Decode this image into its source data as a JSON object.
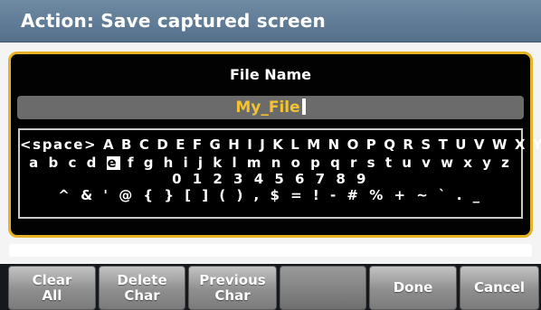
{
  "title": "Action: Save captured screen",
  "dialog": {
    "label": "File Name",
    "file_name_value": "My_File"
  },
  "charset": {
    "row1": "<space> A B C D E F G H I J K L M N O P Q R S T U V W X Y Z",
    "row2_before": "a b c d ",
    "row2_selected": "e",
    "row2_after": " f g h i j k l m n o p q r s t u v w x y z",
    "row3": "0 1 2 3 4 5 6 7 8 9",
    "row4": "^ & ' @ { } [ ] ( ) , $ = ! - # % + ~ ` . _"
  },
  "softkeys": {
    "clear_all": [
      "Clear",
      "All"
    ],
    "delete_char": [
      "Delete",
      "Char"
    ],
    "previous_char": [
      "Previous",
      "Char"
    ],
    "done": "Done",
    "cancel": "Cancel"
  },
  "colors": {
    "title_bar": "#6381a0",
    "dialog_border": "#e6b325",
    "file_name_text": "#f3c332"
  }
}
